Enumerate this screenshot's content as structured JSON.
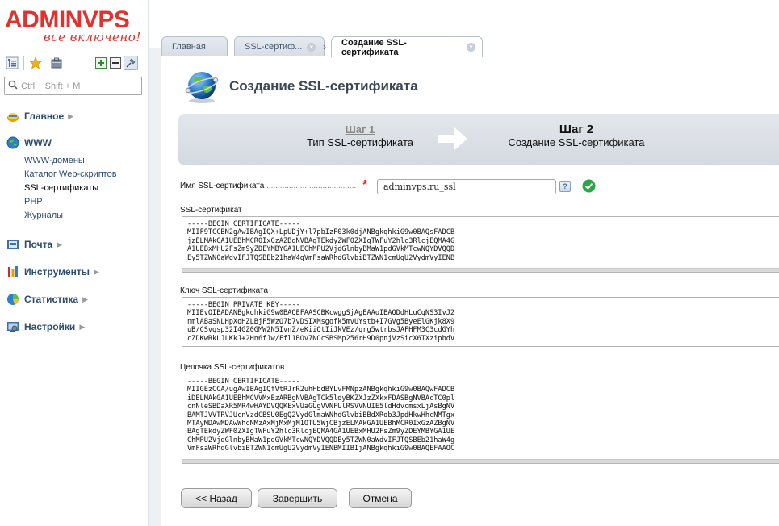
{
  "logo": {
    "main": "ADMINVPS",
    "tagline": "все включено!"
  },
  "toolbar": {
    "icons": [
      "tree-icon",
      "favorites-star-icon",
      "briefcase-icon",
      "expand-all-icon",
      "collapse-all-icon",
      "pin-icon"
    ]
  },
  "search": {
    "placeholder": "Ctrl + Shift + M"
  },
  "sidebar": {
    "groups": [
      {
        "label": "Главное",
        "icon": "main-icon"
      },
      {
        "label": "WWW",
        "icon": "www-globe-icon",
        "items": [
          "WWW-домены",
          "Каталог Web-скриптов",
          "SSL-сертификаты",
          "PHP",
          "Журналы"
        ],
        "active_item": "SSL-сертификаты"
      },
      {
        "label": "Почта",
        "icon": "mail-icon"
      },
      {
        "label": "Инструменты",
        "icon": "tools-icon"
      },
      {
        "label": "Статистика",
        "icon": "stats-icon"
      },
      {
        "label": "Настройки",
        "icon": "settings-icon"
      }
    ]
  },
  "tabs": [
    {
      "label": "Главная"
    },
    {
      "label": "SSL-сертиф..."
    },
    {
      "label": "Создание SSL-сертификата"
    }
  ],
  "page": {
    "title": "Создание SSL-сертификата"
  },
  "wizard": {
    "step1_title": "Шаг 1",
    "step1_sub": "Тип SSL-сертификата",
    "step2_title": "Шаг 2",
    "step2_sub": "Создание SSL-сертификата"
  },
  "form": {
    "name_label": "Имя SSL-сертификата",
    "name_value": "adminvps.ru_ssl",
    "required_mark": "*",
    "help": "?",
    "cert_label": "SSL-сертификат",
    "cert_value": "-----BEGIN CERTIFICATE-----\nMIIF9TCCBN2gAwIBAgIQX+LpUDjY+l7pbIzF03k0djANBgkqhkiG9w0BAQsFADCB\njzELMAkGA1UEBhMCR0IxGzAZBgNVBAgTEkdyZWF0ZXIgTWFuY2hlc3RlcjEQMA4G\nA1UEBxMHU2FsZm9yZDEYMBYGA1UEChMPU2VjdGlnbyBMaW1pdGVkMTcwNQYDVQQD\nEy5TZWN0aWdvIFJTQSBEb21haW4gVmFsaWRhdGlvbiBTZWN1cmUgU2VydmVyIENB",
    "key_label": "Ключ SSL-сертификата",
    "key_value": "-----BEGIN PRIVATE KEY-----\nMIIEvQIBADANBgkqhkiG9w0BAQEFAASCBKcwggSjAgEAAoIBAQDdHLuCqNS3IvJ2\nnmlABaSNLHpXoHZLBjF5WzQ7b7vDSIXMsgofk5mvUYstb+I7GVg5ByeElGKjk8X9\nuB/CSvqsp32I4GZ0GMW2N5IvnZ/eKiiQtIiJkVEz/qrg5wtrbsJAFHFM3C3cdGYh\ncZDKwRkLJLKkJ+2Hn6fJw/Ffl1BOv7NOcSBSMp256rH9D0pnjVzSicX6TXzipbdV",
    "chain_label": "Цепочка SSL-сертификатов",
    "chain_value": "-----BEGIN CERTIFICATE-----\nMIIGEzCCA/ugAwIBAgIQfVtRJrR2uhHbdBYLvFMNpzANBgkqhkiG9w0BAQwFADCB\niDELMAkGA1UEBhMCVVMxEzARBgNVBAgTCk5ldyBKZXJzZXkxFDASBgNVBAcTC0pl\ncnNleSBDaXR5MR4wHAYDVQQKExVUaGUgVVNFUlRSVVNUIE5ldHdvcmsxLjAsBgNV\nBAMTJVVTRVJUcnVzdCBSU0EgQ2VydGlmaWNhdGlvbiBBdXRob3JpdHkwHhcNMTgx\nMTAyMDAwMDAwWhcNMzAxMjMxMjM1OTU5WjCBjzELMAkGA1UEBhMCR0IxGzAZBgNV\nBAgTEkdyZWF0ZXIgTWFuY2hlc3RlcjEQMA4GA1UEBxMHU2FsZm9yZDEYMBYGA1UE\nChMPU2VjdGlnbyBMaW1pdGVkMTcwNQYDVQQDEy5TZWN0aWdvIFJTQSBEb21haW4g\nVmFsaWRhdGlvbiBTZWN1cmUgU2VydmVyIENBMIIBIjANBgkqhkiG9w0BAQEFAAOC"
  },
  "buttons": {
    "back": "<< Назад",
    "finish": "Завершить",
    "cancel": "Отмена"
  },
  "colors": {
    "brand_red": "#e3312d",
    "nav_blue": "#2b4c6f",
    "wizard_bg": "#d9dee4",
    "ok_green": "#27a844"
  }
}
